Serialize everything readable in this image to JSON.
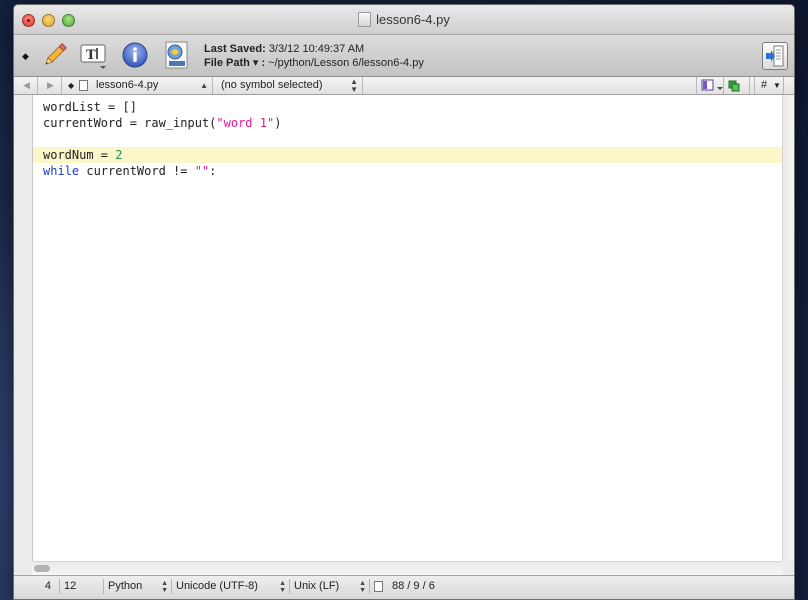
{
  "window": {
    "title": "lesson6-4.py"
  },
  "toolbar": {
    "last_saved_label": "Last Saved:",
    "last_saved_value": "3/3/12 10:49:37 AM",
    "file_path_label": "File Path ▾ :",
    "file_path_value": "~/python/Lesson 6/lesson6-4.py"
  },
  "navbar": {
    "file_name": "lesson6-4.py",
    "symbol": "(no symbol selected)",
    "hash_label": "#"
  },
  "editor": {
    "lines": [
      "wordList = []",
      "currentWord = raw_input(\"word 1\")",
      "",
      "wordNum = 2",
      "while currentWord != \"\":"
    ],
    "tokens": {
      "line1": "wordList = []",
      "line2_pre": "currentWord = raw_input(",
      "line2_str": "\"word 1\"",
      "line2_post": ")",
      "line4_pre": "wordNum = ",
      "line4_num": "2",
      "line5_kw": "while",
      "line5_mid": " currentWord != ",
      "line5_str": "\"\"",
      "line5_post": ":"
    },
    "current_line_index": 3
  },
  "statusbar": {
    "line": "4",
    "column": "12",
    "language": "Python",
    "encoding": "Unicode (UTF-8)",
    "line_endings": "Unix (LF)",
    "doc_stats": "88 / 9 / 6"
  },
  "colors": {
    "keyword": "#1b3fc5",
    "string": "#e0199a",
    "number": "#2a8a5a",
    "current_line": "#fbf7c9"
  }
}
